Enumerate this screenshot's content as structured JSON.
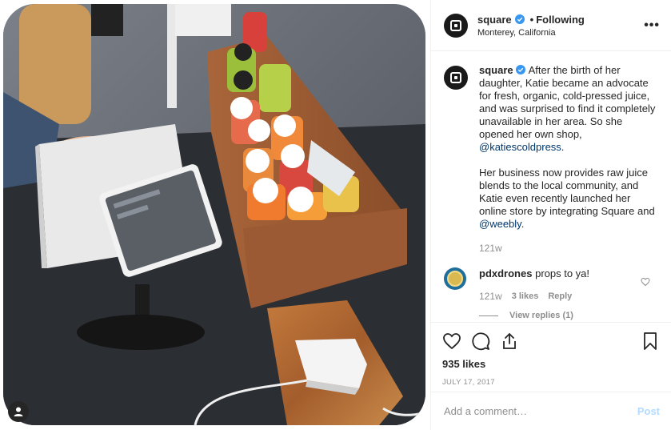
{
  "account": {
    "username": "square",
    "follow_status": "Following",
    "location": "Monterey, California",
    "verified": true
  },
  "header": {
    "separator": "•",
    "more_icon": "more-options-icon",
    "more_label": "•••"
  },
  "caption": {
    "username": "square",
    "para1": "After the birth of her daughter, Katie became an advocate for fresh, organic, cold-pressed juice, and was surprised to find it completely unavailable in her area. So she opened her own shop,",
    "mention1": "@katiescoldpress",
    "para1_end": ".",
    "para2": "Her business now provides raw juice blends to the local community, and Katie even recently launched her online store by integrating Square and",
    "mention2": "@weebly",
    "para2_end": ".",
    "time": "121w"
  },
  "comments": [
    {
      "username": "pdxdrones",
      "text": "props to ya!",
      "time": "121w",
      "likes": "3 likes",
      "reply": "Reply",
      "view_replies": "View replies (1)"
    }
  ],
  "actions": {
    "like_icon": "heart-icon",
    "comment_icon": "comment-icon",
    "share_icon": "share-icon",
    "save_icon": "bookmark-icon"
  },
  "likes": "935 likes",
  "date": "JULY 17, 2017",
  "add_comment": {
    "placeholder": "Add a comment…",
    "post_label": "Post"
  },
  "colors": {
    "text": "#262626",
    "secondary": "#8e8e8e",
    "link": "#00376b",
    "verified": "#3897f0",
    "post_disabled": "#b3dbff",
    "border": "#efefef"
  }
}
